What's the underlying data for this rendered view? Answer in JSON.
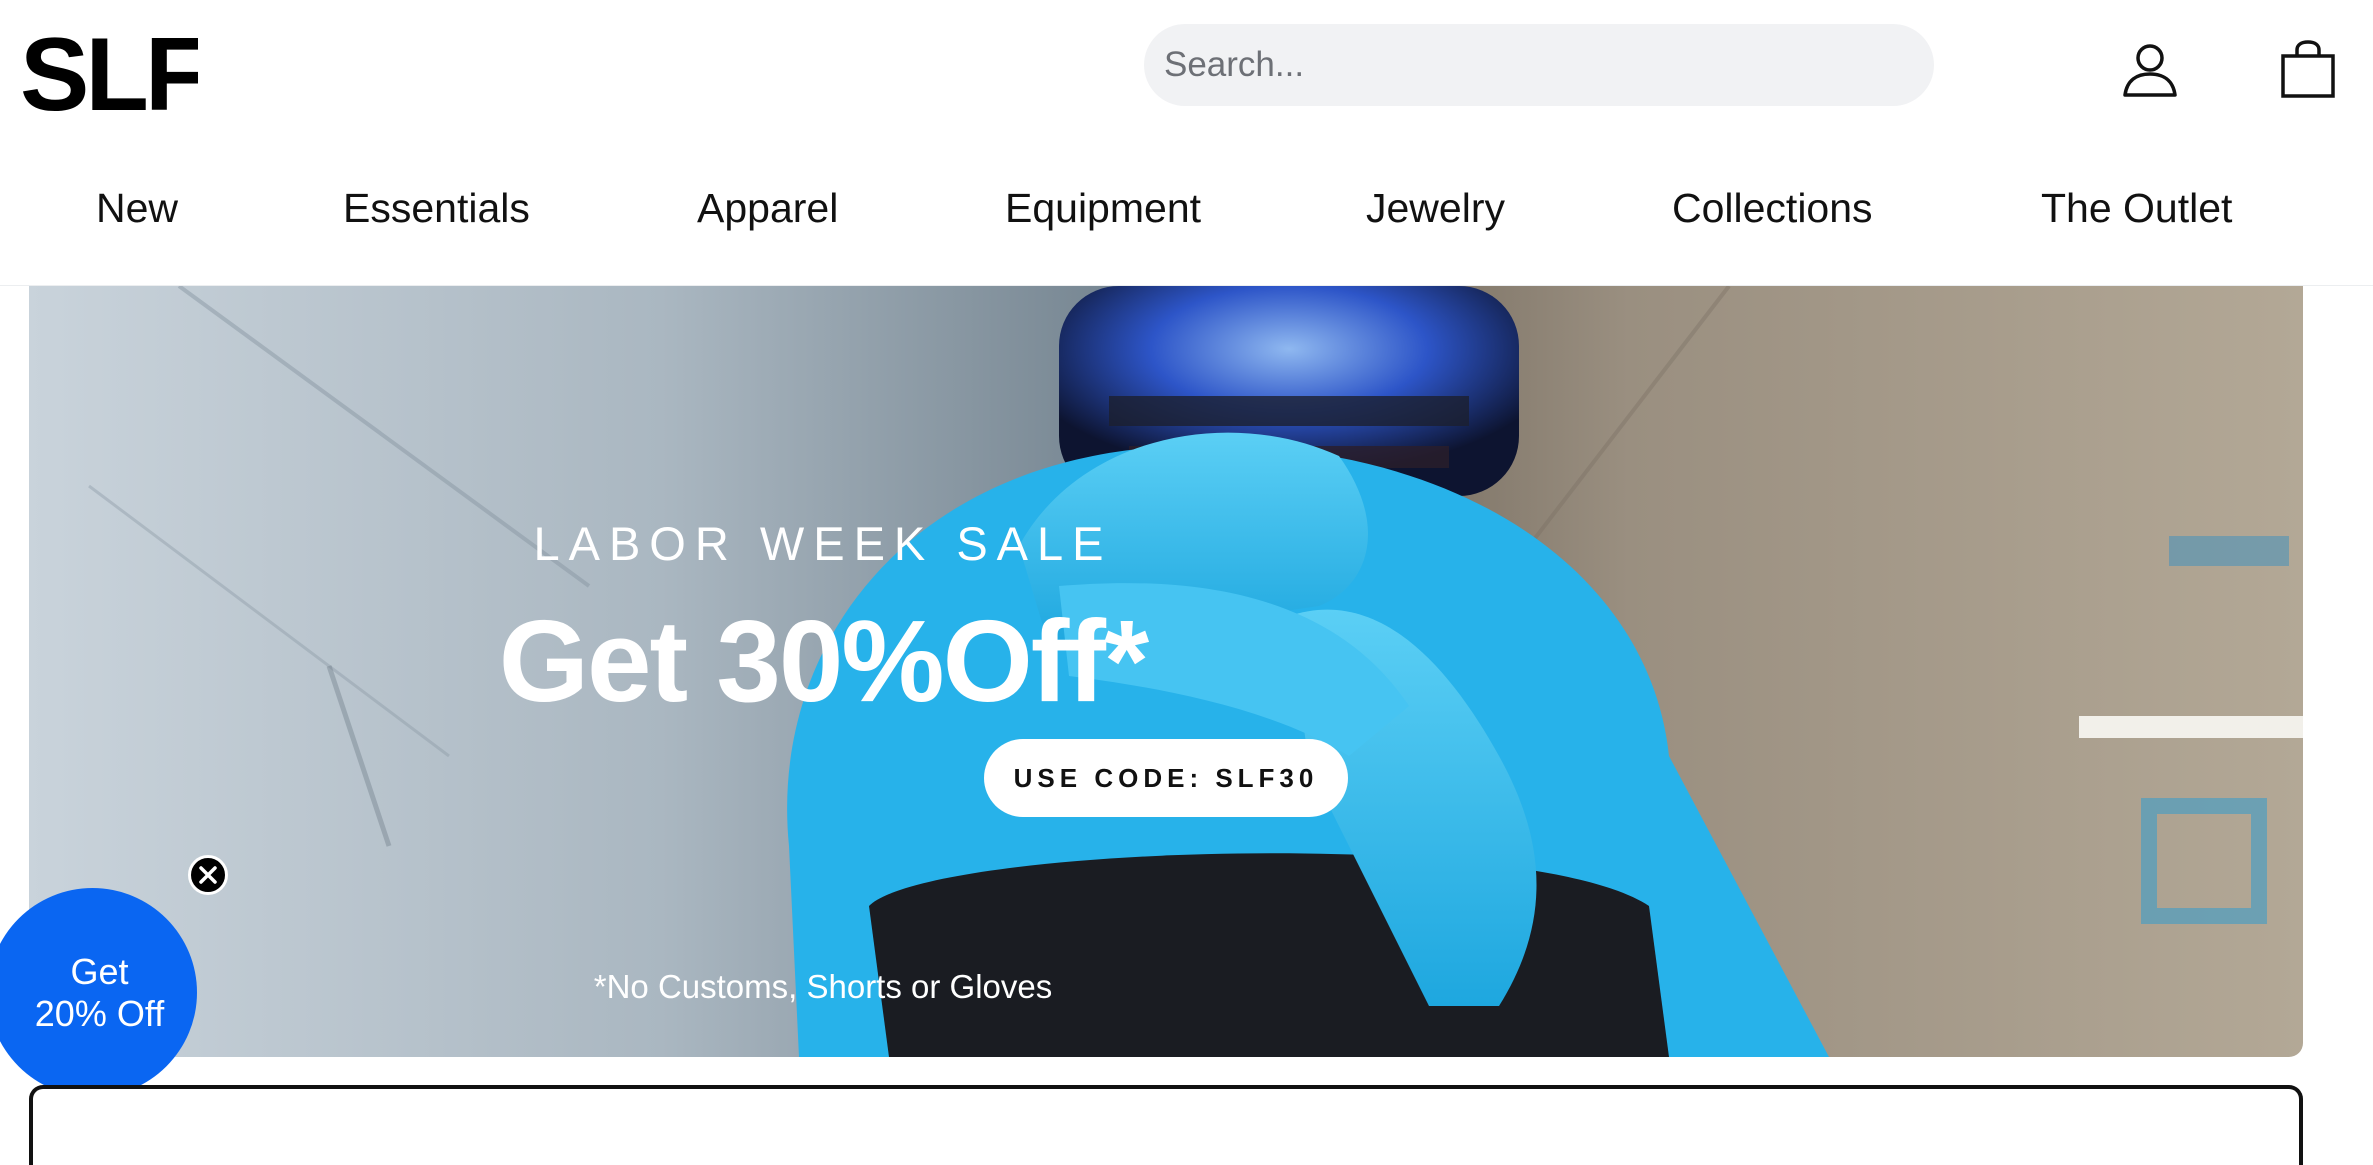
{
  "brand": {
    "logo_text": "SLF"
  },
  "search": {
    "placeholder": "Search..."
  },
  "header_icons": {
    "account": "user-icon",
    "cart": "shopping-bag-icon"
  },
  "nav": {
    "items": [
      {
        "label": "New"
      },
      {
        "label": "Essentials"
      },
      {
        "label": "Apparel"
      },
      {
        "label": "Equipment"
      },
      {
        "label": "Jewelry"
      },
      {
        "label": "Collections"
      },
      {
        "label": "The Outlet"
      }
    ]
  },
  "hero": {
    "eyebrow": "LABOR WEEK SALE",
    "title": "Get 30%Off*",
    "code_button": "USE CODE: SLF30",
    "disclaimer": "*No Customs, Shorts or Gloves"
  },
  "offer_badge": {
    "text": "Get 20% Off",
    "close_icon": "close-icon"
  },
  "colors": {
    "accent": "#0a66f2",
    "glove_blue": "#29b6ea",
    "text": "#111111"
  }
}
